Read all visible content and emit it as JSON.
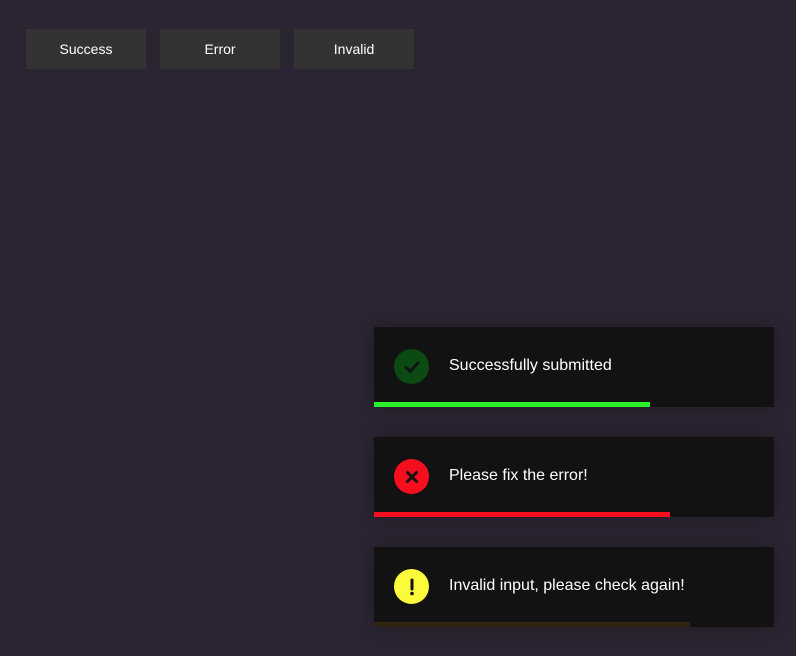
{
  "buttons": [
    {
      "label": "Success"
    },
    {
      "label": "Error"
    },
    {
      "label": "Invalid"
    }
  ],
  "toasts": [
    {
      "message": "Successfully submitted",
      "icon": "check-icon",
      "icon_bg": "#0b4a12",
      "icon_fg": "#121212",
      "bar_color": "#2df02d",
      "progress": 0.69
    },
    {
      "message": "Please fix the error!",
      "icon": "x-icon",
      "icon_bg": "#f50f1e",
      "icon_fg": "#121212",
      "bar_color": "#f50f1e",
      "progress": 0.74
    },
    {
      "message": "Invalid input, please check again!",
      "icon": "exclamation-icon",
      "icon_bg": "#fbfb3c",
      "icon_fg": "#121212",
      "bar_color": "#2d2510",
      "progress": 0.79
    }
  ]
}
